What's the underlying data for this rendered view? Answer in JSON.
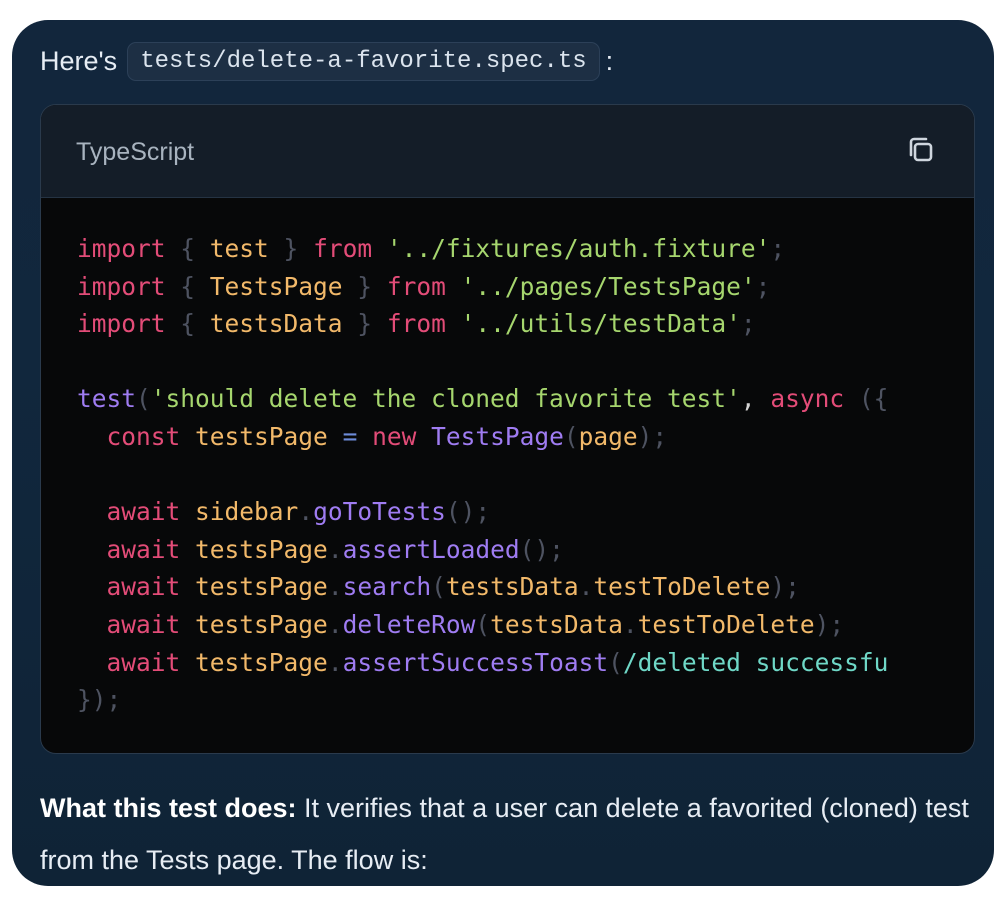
{
  "message": {
    "intro_prefix": "Here's",
    "filename": "tests/delete-a-favorite.spec.ts",
    "intro_suffix": ":"
  },
  "code_block": {
    "language": "TypeScript",
    "copy_icon": "copy-icon",
    "lines": [
      [
        {
          "t": "import",
          "c": "kw"
        },
        {
          "t": " { ",
          "c": "punc"
        },
        {
          "t": "test",
          "c": "id"
        },
        {
          "t": " } ",
          "c": "punc"
        },
        {
          "t": "from",
          "c": "kw"
        },
        {
          "t": " ",
          "c": "plain"
        },
        {
          "t": "'../fixtures/auth.fixture'",
          "c": "str"
        },
        {
          "t": ";",
          "c": "punc"
        }
      ],
      [
        {
          "t": "import",
          "c": "kw"
        },
        {
          "t": " { ",
          "c": "punc"
        },
        {
          "t": "TestsPage",
          "c": "id"
        },
        {
          "t": " } ",
          "c": "punc"
        },
        {
          "t": "from",
          "c": "kw"
        },
        {
          "t": " ",
          "c": "plain"
        },
        {
          "t": "'../pages/TestsPage'",
          "c": "str"
        },
        {
          "t": ";",
          "c": "punc"
        }
      ],
      [
        {
          "t": "import",
          "c": "kw"
        },
        {
          "t": " { ",
          "c": "punc"
        },
        {
          "t": "testsData",
          "c": "id"
        },
        {
          "t": " } ",
          "c": "punc"
        },
        {
          "t": "from",
          "c": "kw"
        },
        {
          "t": " ",
          "c": "plain"
        },
        {
          "t": "'../utils/testData'",
          "c": "str"
        },
        {
          "t": ";",
          "c": "punc"
        }
      ],
      [],
      [
        {
          "t": "test",
          "c": "fn"
        },
        {
          "t": "(",
          "c": "punc"
        },
        {
          "t": "'should delete the cloned favorite test'",
          "c": "str"
        },
        {
          "t": ", ",
          "c": "plain"
        },
        {
          "t": "async",
          "c": "kw"
        },
        {
          "t": " ({",
          "c": "punc"
        }
      ],
      [
        {
          "t": "  ",
          "c": "plain"
        },
        {
          "t": "const",
          "c": "kw"
        },
        {
          "t": " ",
          "c": "plain"
        },
        {
          "t": "testsPage",
          "c": "id"
        },
        {
          "t": " = ",
          "c": "op"
        },
        {
          "t": "new",
          "c": "kw"
        },
        {
          "t": " ",
          "c": "plain"
        },
        {
          "t": "TestsPage",
          "c": "fn"
        },
        {
          "t": "(",
          "c": "punc"
        },
        {
          "t": "page",
          "c": "id"
        },
        {
          "t": ");",
          "c": "punc"
        }
      ],
      [],
      [
        {
          "t": "  ",
          "c": "plain"
        },
        {
          "t": "await",
          "c": "kw"
        },
        {
          "t": " ",
          "c": "plain"
        },
        {
          "t": "sidebar",
          "c": "id"
        },
        {
          "t": ".",
          "c": "punc"
        },
        {
          "t": "goToTests",
          "c": "fn"
        },
        {
          "t": "();",
          "c": "punc"
        }
      ],
      [
        {
          "t": "  ",
          "c": "plain"
        },
        {
          "t": "await",
          "c": "kw"
        },
        {
          "t": " ",
          "c": "plain"
        },
        {
          "t": "testsPage",
          "c": "id"
        },
        {
          "t": ".",
          "c": "punc"
        },
        {
          "t": "assertLoaded",
          "c": "fn"
        },
        {
          "t": "();",
          "c": "punc"
        }
      ],
      [
        {
          "t": "  ",
          "c": "plain"
        },
        {
          "t": "await",
          "c": "kw"
        },
        {
          "t": " ",
          "c": "plain"
        },
        {
          "t": "testsPage",
          "c": "id"
        },
        {
          "t": ".",
          "c": "punc"
        },
        {
          "t": "search",
          "c": "fn"
        },
        {
          "t": "(",
          "c": "punc"
        },
        {
          "t": "testsData",
          "c": "id"
        },
        {
          "t": ".",
          "c": "punc"
        },
        {
          "t": "testToDelete",
          "c": "id"
        },
        {
          "t": ");",
          "c": "punc"
        }
      ],
      [
        {
          "t": "  ",
          "c": "plain"
        },
        {
          "t": "await",
          "c": "kw"
        },
        {
          "t": " ",
          "c": "plain"
        },
        {
          "t": "testsPage",
          "c": "id"
        },
        {
          "t": ".",
          "c": "punc"
        },
        {
          "t": "deleteRow",
          "c": "fn"
        },
        {
          "t": "(",
          "c": "punc"
        },
        {
          "t": "testsData",
          "c": "id"
        },
        {
          "t": ".",
          "c": "punc"
        },
        {
          "t": "testToDelete",
          "c": "id"
        },
        {
          "t": ");",
          "c": "punc"
        }
      ],
      [
        {
          "t": "  ",
          "c": "plain"
        },
        {
          "t": "await",
          "c": "kw"
        },
        {
          "t": " ",
          "c": "plain"
        },
        {
          "t": "testsPage",
          "c": "id"
        },
        {
          "t": ".",
          "c": "punc"
        },
        {
          "t": "assertSuccessToast",
          "c": "fn"
        },
        {
          "t": "(",
          "c": "punc"
        },
        {
          "t": "/deleted successfu",
          "c": "regex"
        }
      ],
      [
        {
          "t": "});",
          "c": "punc"
        }
      ]
    ]
  },
  "explanation": {
    "heading": "What this test does:",
    "body": "It verifies that a user can delete a favorited (cloned) test from the Tests page. The flow is:"
  }
}
